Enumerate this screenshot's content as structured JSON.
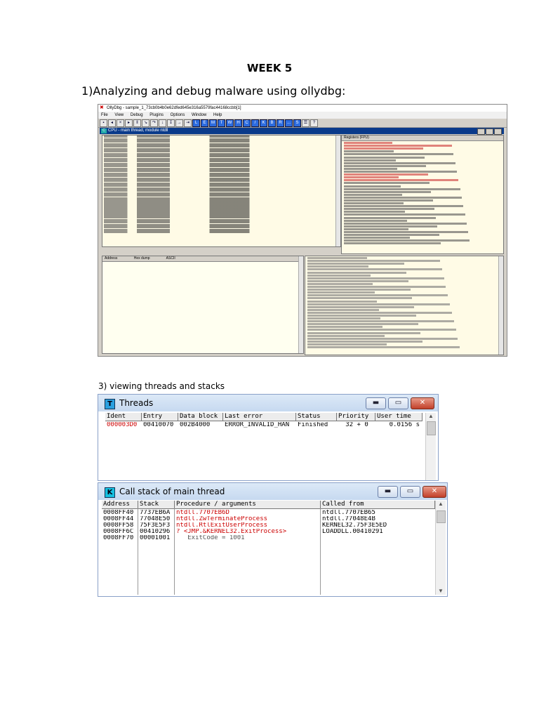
{
  "document": {
    "title": "WEEK 5",
    "heading": "1)Analyzing and debug malware using ollydbg:",
    "caption": "3) viewing threads and stacks"
  },
  "ollydbg": {
    "window_title": "OllyDbg - sample_1_73cb0b4b0e62dfed645e316a5579fac44168ccbb[1]",
    "menu": [
      "File",
      "View",
      "Debug",
      "Plugins",
      "Options",
      "Window",
      "Help"
    ],
    "toolbar_letters": [
      "L",
      "E",
      "M",
      "T",
      "W",
      "H",
      "C",
      "/",
      "K",
      "B",
      "R",
      "...",
      "S"
    ],
    "cpu_title": "CPU - main thread, module ntdll",
    "registers_header": "Registers (FPU)",
    "dump_headers": [
      "Address",
      "Hex dump",
      "ASCII"
    ]
  },
  "threads_window": {
    "title": "Threads",
    "icon_letter": "T",
    "columns": [
      "Ident",
      "Entry",
      "Data block",
      "Last error",
      "Status",
      "Priority",
      "User time"
    ],
    "rows": [
      [
        "000003D0",
        "00410070",
        "002B4000",
        "ERROR_INVALID_HAN",
        "Finished",
        "32 + 0",
        "0.0156 s"
      ]
    ]
  },
  "callstack_window": {
    "title": "Call stack of main thread",
    "icon_letter": "K",
    "columns": [
      "Address",
      "Stack",
      "Procedure / arguments",
      "Called from"
    ],
    "rows": [
      [
        "0008FF40",
        "7737EB6A",
        "ntdll.7707EB6D",
        "ntdll.7707EB65"
      ],
      [
        "0008FF44",
        "77048E50",
        "ntdll.ZwTerminateProcess",
        "ntdll.77048E4B"
      ],
      [
        "0008FF58",
        "75F3E5F3",
        "ntdll.RtlExitUserProcess",
        "KERNEL32.75F3E5ED"
      ],
      [
        "0008FF6C",
        "00410296",
        "? <JMP.&KERNEL32.ExitProcess>",
        "LOADDLL.00410291"
      ],
      [
        "0008FF70",
        "00001001",
        "   ExitCode = 1001",
        ""
      ]
    ]
  },
  "colors": {
    "accent_red": "#cc0000",
    "olly_pane": "#fffbe6",
    "titlebar_blue": "#c6d9f0"
  }
}
